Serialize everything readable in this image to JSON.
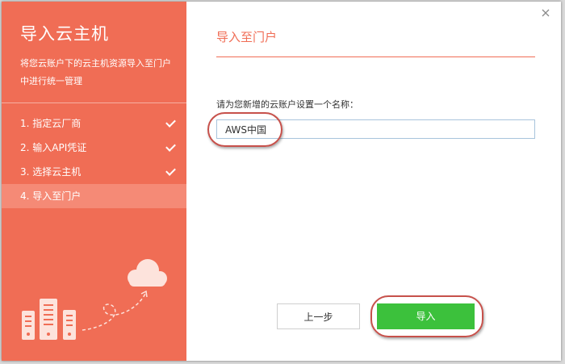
{
  "sidebar": {
    "title": "导入云主机",
    "description": "将您云账户下的云主机资源导入至门户中进行统一管理",
    "steps": [
      {
        "label": "1. 指定云厂商",
        "done": true
      },
      {
        "label": "2. 输入API凭证",
        "done": true
      },
      {
        "label": "3. 选择云主机",
        "done": true
      },
      {
        "label": "4. 导入至门户",
        "done": false,
        "active": true
      }
    ],
    "illustration_icons": [
      "server-rack-icon",
      "cloud-icon",
      "upload-arrow-icon"
    ]
  },
  "main": {
    "title": "导入至门户",
    "field_label": "请为您新增的云账户设置一个名称：",
    "account_name": "AWS中国"
  },
  "buttons": {
    "prev": "上一步",
    "import": "导入"
  },
  "colors": {
    "accent": "#f06d55",
    "active_step": "#f58a76",
    "primary_button": "#3cc13c",
    "annotation": "#c7514b"
  }
}
